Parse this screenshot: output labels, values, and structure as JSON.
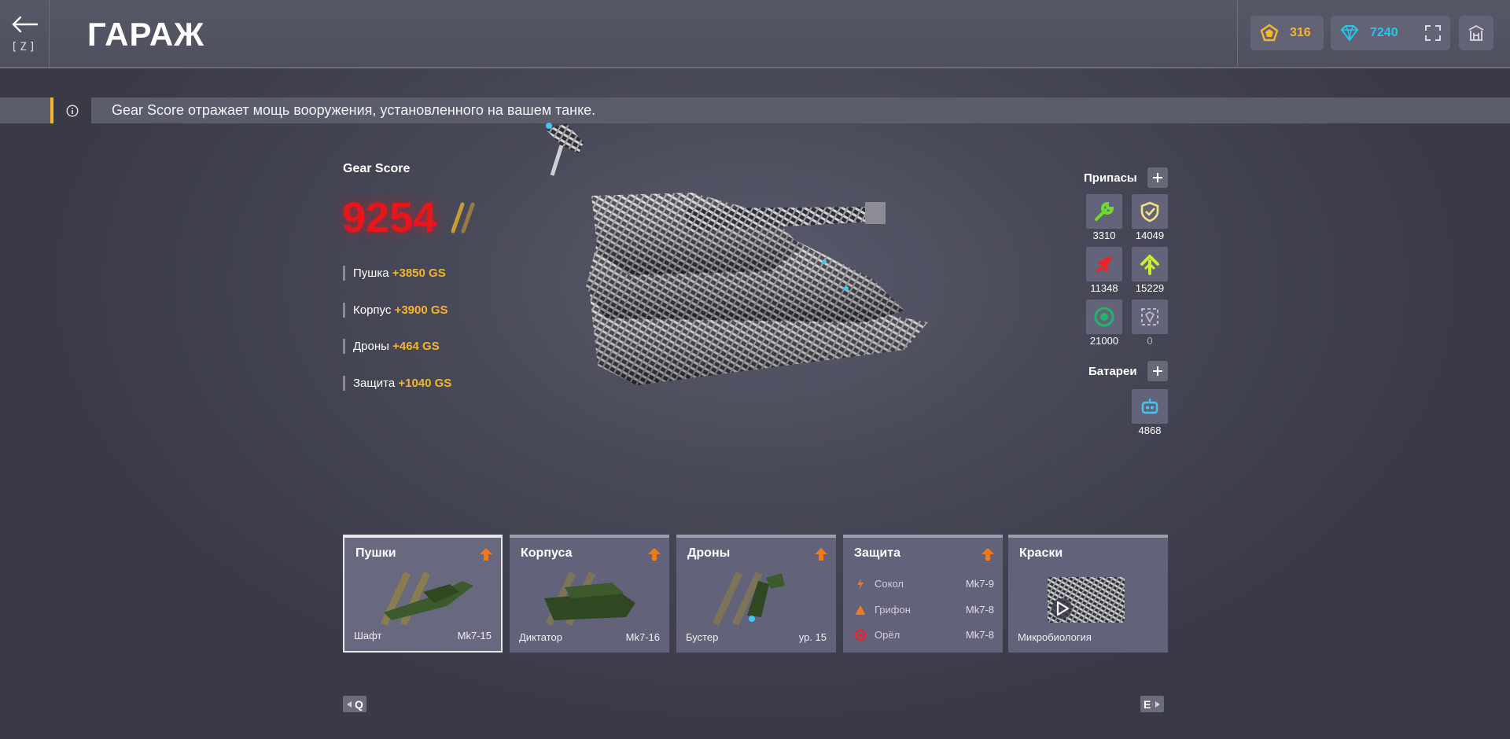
{
  "header": {
    "back_key": "[Z]",
    "title": "ГАРАЖ",
    "crystals": "316",
    "gems": "7240",
    "icons": [
      "back-arrow-icon",
      "crystal-icon",
      "diamond-icon",
      "fullscreen-icon",
      "lobby-icon"
    ],
    "colors": {
      "crystal": "#f5b52a",
      "gem": "#26c6f0",
      "accent": "#f5b52a"
    }
  },
  "info": {
    "text": "Gear Score отражает мощь вооружения, установленного на вашем танке."
  },
  "gear_score": {
    "label": "Gear Score",
    "value": "9254",
    "color": "#e8151b",
    "items": [
      {
        "name": "Пушка",
        "value": "+3850 GS"
      },
      {
        "name": "Корпус",
        "value": "+3900 GS"
      },
      {
        "name": "Дроны",
        "value": "+464 GS"
      },
      {
        "name": "Защита",
        "value": "+1040 GS"
      }
    ]
  },
  "supplies": {
    "title": "Припасы",
    "items": [
      {
        "icon": "repair-kit-icon",
        "count": "3310",
        "color": "#6bdc2f"
      },
      {
        "icon": "double-armor-icon",
        "count": "14049",
        "color": "#f4e27a"
      },
      {
        "icon": "double-damage-icon",
        "count": "11348",
        "color": "#e8262a"
      },
      {
        "icon": "speed-boost-icon",
        "count": "15229",
        "color": "#c6f02c"
      },
      {
        "icon": "mine-icon",
        "count": "21000",
        "color": "#1fb56b"
      },
      {
        "icon": "gold-box-icon",
        "count": "0",
        "color": "#b9b9c4"
      }
    ]
  },
  "batteries": {
    "title": "Батареи",
    "items": [
      {
        "icon": "battery-drone-icon",
        "count": "4868",
        "color": "#3fc8f2"
      }
    ]
  },
  "cards": {
    "weapons": {
      "title": "Пушки",
      "item": "Шафт",
      "mod": "Mk7-15"
    },
    "hulls": {
      "title": "Корпуса",
      "item": "Диктатор",
      "mod": "Mk7-16"
    },
    "drones": {
      "title": "Дроны",
      "item": "Бустер",
      "mod": "ур. 15"
    },
    "protection": {
      "title": "Защита",
      "rows": [
        {
          "icon": "falcon-icon",
          "name": "Сокол",
          "mod": "Mk7-9"
        },
        {
          "icon": "griffin-icon",
          "name": "Грифон",
          "mod": "Mk7-8"
        },
        {
          "icon": "eagle-icon",
          "name": "Орёл",
          "mod": "Mk7-8"
        }
      ]
    },
    "paints": {
      "title": "Краски",
      "item": "Микробиология"
    }
  },
  "nav": {
    "prev_key": "Q",
    "next_key": "E"
  }
}
